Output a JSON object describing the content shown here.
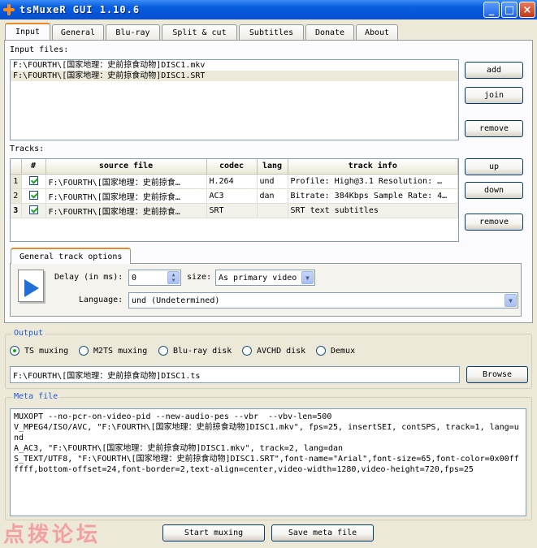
{
  "window": {
    "title": "tsMuxeR GUI 1.10.6",
    "minimize": "_",
    "maximize": "□",
    "close": "×"
  },
  "tabs": [
    "Input",
    "General",
    "Blu-ray",
    "Split & cut",
    "Subtitles",
    "Donate",
    "About"
  ],
  "input_files": {
    "label": "Input files:",
    "items": [
      "F:\\FOURTH\\[国家地理：史前掠食动物]DISC1.mkv",
      "F:\\FOURTH\\[国家地理：史前掠食动物]DISC1.SRT"
    ],
    "buttons": {
      "add": "add",
      "join": "join",
      "remove": "remove"
    }
  },
  "tracks": {
    "label": "Tracks:",
    "columns": [
      "#",
      "source file",
      "codec",
      "lang",
      "track info"
    ],
    "rows": [
      {
        "num": "1",
        "source": "F:\\FOURTH\\[国家地理：史前掠食…",
        "codec": "H.264",
        "lang": "und",
        "info": "Profile: High@3.1  Resolution: …"
      },
      {
        "num": "2",
        "source": "F:\\FOURTH\\[国家地理：史前掠食…",
        "codec": "AC3",
        "lang": "dan",
        "info": "Bitrate: 384Kbps Sample Rate: 4…"
      },
      {
        "num": "3",
        "source": "F:\\FOURTH\\[国家地理：史前掠食…",
        "codec": "SRT",
        "lang": "",
        "info": "SRT text subtitles"
      }
    ],
    "buttons": {
      "up": "up",
      "down": "down",
      "remove": "remove"
    }
  },
  "track_options": {
    "tab_label": "General track options",
    "delay_label": "Delay (in ms):",
    "delay_value": "0",
    "size_label": "size:",
    "size_value": "As primary video",
    "language_label": "Language:",
    "language_value": "und (Undetermined)"
  },
  "output": {
    "title": "Output",
    "options": [
      "TS muxing",
      "M2TS muxing",
      "Blu-ray disk",
      "AVCHD disk",
      "Demux"
    ],
    "selected": "TS muxing",
    "path": "F:\\FOURTH\\[国家地理：史前掠食动物]DISC1.ts",
    "browse": "Browse"
  },
  "meta_file": {
    "title": "Meta file",
    "lines": [
      "MUXOPT --no-pcr-on-video-pid --new-audio-pes --vbr  --vbv-len=500",
      "V_MPEG4/ISO/AVC, \"F:\\FOURTH\\[国家地理：史前掠食动物]DISC1.mkv\", fps=25, insertSEI, contSPS, track=1, lang=und",
      "A_AC3, \"F:\\FOURTH\\[国家地理：史前掠食动物]DISC1.mkv\", track=2, lang=dan",
      "S_TEXT/UTF8, \"F:\\FOURTH\\[国家地理：史前掠食动物]DISC1.SRT\",font-name=\"Arial\",font-size=65,font-color=0x00ffffff,bottom-offset=24,font-border=2,text-align=center,video-width=1280,video-height=720,fps=25"
    ]
  },
  "footer": {
    "start": "Start muxing",
    "save": "Save meta file",
    "watermark": "点拨论坛"
  },
  "colors": {
    "titlebar": "#0554d8",
    "group_title": "#2157d6",
    "check_green": "#21a121",
    "tab_accent": "#e68b2c"
  }
}
